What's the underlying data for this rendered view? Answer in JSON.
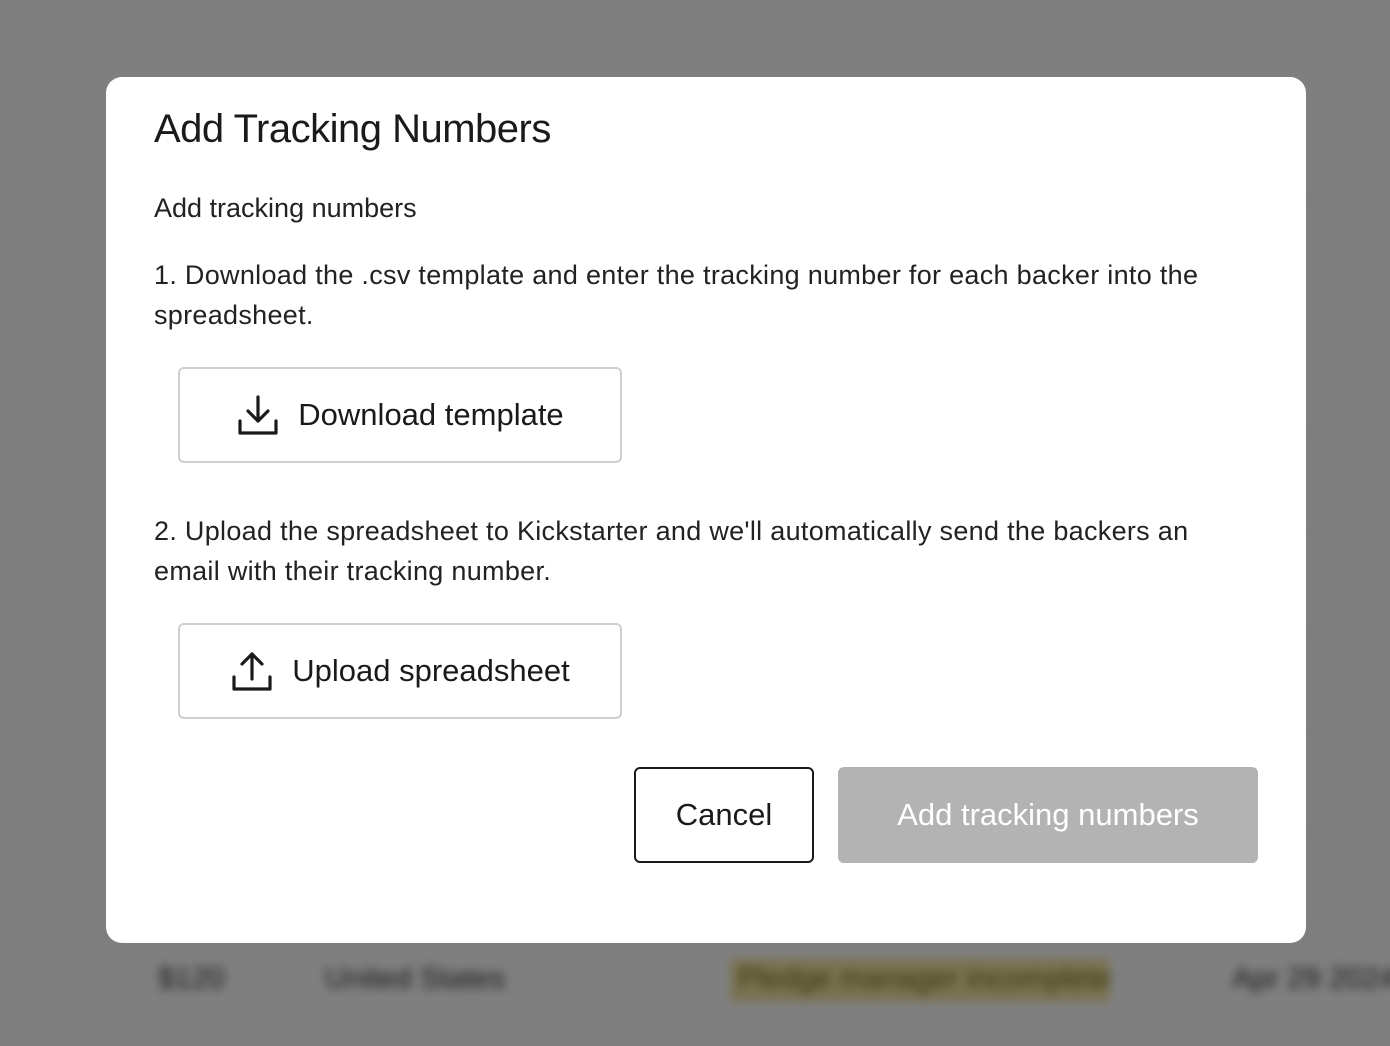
{
  "modal": {
    "title": "Add Tracking Numbers",
    "subtitle": "Add tracking numbers",
    "step1_text": "1. Download the .csv template and enter the tracking number for each backer into the spreadsheet.",
    "download_button": {
      "label": "Download template",
      "icon": "download-icon"
    },
    "step2_text": "2. Upload the spreadsheet to Kickstarter and we'll automatically send the backers an email with their tracking number.",
    "upload_button": {
      "label": "Upload spreadsheet",
      "icon": "upload-icon"
    },
    "cancel_label": "Cancel",
    "submit_label": "Add tracking numbers",
    "submit_disabled": true
  },
  "background": {
    "row_amount": "$120",
    "row_country": "United States",
    "row_status": "Pledge manager incomplete",
    "row_date": "Apr 29 2024"
  },
  "colors": {
    "overlay": "rgba(0,0,0,0.5)",
    "disabled_button": "#b3b3b3",
    "status_badge": "#f3e7a5"
  }
}
